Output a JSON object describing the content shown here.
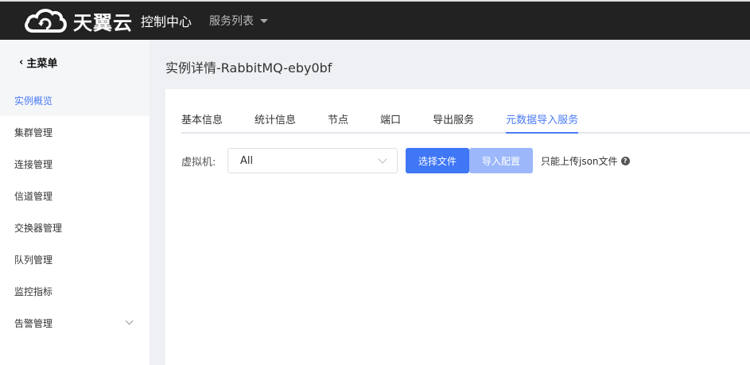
{
  "header": {
    "brand": "天翼云",
    "console": "控制中心",
    "services": "服务列表"
  },
  "sidebar": {
    "back": "主菜单",
    "items": [
      {
        "label": "实例概览"
      },
      {
        "label": "集群管理"
      },
      {
        "label": "连接管理"
      },
      {
        "label": "信道管理"
      },
      {
        "label": "交换器管理"
      },
      {
        "label": "队列管理"
      },
      {
        "label": "监控指标"
      },
      {
        "label": "告警管理"
      }
    ]
  },
  "page": {
    "title": "实例详情-RabbitMQ-eby0bf"
  },
  "tabs": [
    {
      "label": "基本信息"
    },
    {
      "label": "统计信息"
    },
    {
      "label": "节点"
    },
    {
      "label": "端口"
    },
    {
      "label": "导出服务"
    },
    {
      "label": "元数据导入服务"
    }
  ],
  "form": {
    "vhost_label": "虚拟机:",
    "vhost_value": "All",
    "choose_file": "选择文件",
    "import_config": "导入配置",
    "hint": "只能上传json文件",
    "hint_icon": "?"
  },
  "colors": {
    "accent": "#3f77f6",
    "topbar": "#222222"
  }
}
